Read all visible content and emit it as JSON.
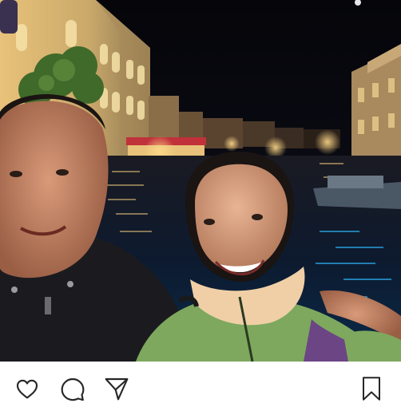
{
  "post": {
    "photo": {
      "subject": "selfie-photo",
      "scene": "night-canal"
    },
    "actions": {
      "like_icon": "heart-outline-icon",
      "comment_icon": "speech-bubble-icon",
      "share_icon": "paper-plane-icon",
      "save_icon": "bookmark-outline-icon",
      "icon_color": "#262626"
    }
  }
}
